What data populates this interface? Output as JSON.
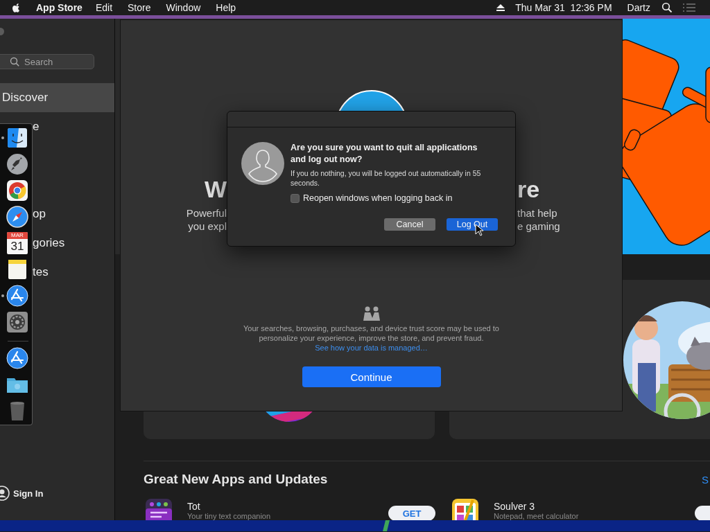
{
  "menu_bar": {
    "app_name": "App Store",
    "menus": [
      "Edit",
      "Store",
      "Window",
      "Help"
    ],
    "clock": "Thu Mar 31  12:36 PM",
    "user": "Dartz"
  },
  "sidebar": {
    "search": {
      "placeholder": "Search"
    },
    "items": [
      {
        "label": "Discover",
        "selected": true
      },
      {
        "label": "e",
        "selected": false
      },
      {
        "label": "op",
        "selected": false
      },
      {
        "label": "gories",
        "selected": false
      },
      {
        "label": "tes",
        "selected": false
      }
    ],
    "account": "Sign In"
  },
  "content": {
    "section_title": "Great New Apps and Updates",
    "see_all": "S",
    "apps": [
      {
        "kind": "tot",
        "name": "Tot",
        "subtitle": "Your tiny text companion",
        "button": "GET"
      },
      {
        "kind": "soulver",
        "name": "Soulver 3",
        "subtitle": "Notepad, meet calculator"
      }
    ]
  },
  "welcome_sheet": {
    "headline_left": "W",
    "headline_right": "re",
    "text_left": [
      "Powerful",
      "you expl"
    ],
    "text_right": [
      "that help",
      "e gaming"
    ],
    "privacy_text": "Your searches, browsing, purchases, and device trust score may be used to personalize your experience, improve the store, and prevent fraud.",
    "privacy_link": "See how your data is managed…",
    "button": "Continue"
  },
  "dialog": {
    "title": "Are you sure you want to quit all applications and log out now?",
    "message": "If you do nothing, you will be logged out automatically in 55 seconds.",
    "checkbox": {
      "label": "Reopen windows when logging back in",
      "checked": false
    },
    "buttons": [
      {
        "label": "Cancel",
        "default": false
      },
      {
        "label": "Log Out",
        "default": true
      }
    ]
  },
  "dock": {
    "apps": [
      {
        "kind": "finder",
        "running": true
      },
      {
        "kind": "launchpad",
        "running": false
      },
      {
        "kind": "browser",
        "running": false
      },
      {
        "kind": "compass",
        "running": false
      },
      {
        "kind": "calendar",
        "month": "MAR",
        "day": "31",
        "running": false
      },
      {
        "kind": "notes",
        "running": false
      },
      {
        "kind": "appstore",
        "running": true
      },
      {
        "kind": "settings",
        "running": false
      }
    ],
    "others": [
      {
        "kind": "appstore",
        "running": false
      },
      {
        "kind": "folder",
        "running": false
      },
      {
        "kind": "trash",
        "running": false
      }
    ]
  }
}
